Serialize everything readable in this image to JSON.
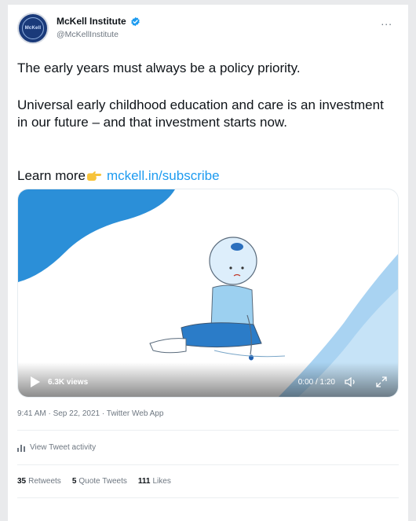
{
  "tweet": {
    "author": {
      "display_name": "McKell Institute",
      "handle": "@McKellInstitute",
      "verified": true,
      "avatar_icon": "mckell-institute-logo"
    },
    "more_label": "...",
    "paragraphs": [
      "The early years must always be a policy priority.",
      "Universal early childhood education and care is an investment in our future – and that investment starts now."
    ],
    "learn_more": {
      "text": "Learn more",
      "emoji_icon": "pointing-hand-emoji",
      "link": "mckell.in/subscribe"
    },
    "media": {
      "type": "video",
      "views": "6.3K views",
      "time": "0:00 / 1:20",
      "icons": [
        "play-icon",
        "volume-icon",
        "expand-icon"
      ]
    },
    "meta": "9:41 AM · Sep 22, 2021 · Twitter Web App",
    "activity_label": "View Tweet activity",
    "stats": [
      {
        "count": "35",
        "label": "Retweets"
      },
      {
        "count": "5",
        "label": "Quote Tweets"
      },
      {
        "count": "111",
        "label": "Likes"
      }
    ]
  },
  "colors": {
    "link": "#1d9bf0",
    "text": "#0f1419",
    "muted": "#6e7781",
    "accent_blue": "#2b8fd8",
    "light_blue": "#a9d3f2"
  }
}
